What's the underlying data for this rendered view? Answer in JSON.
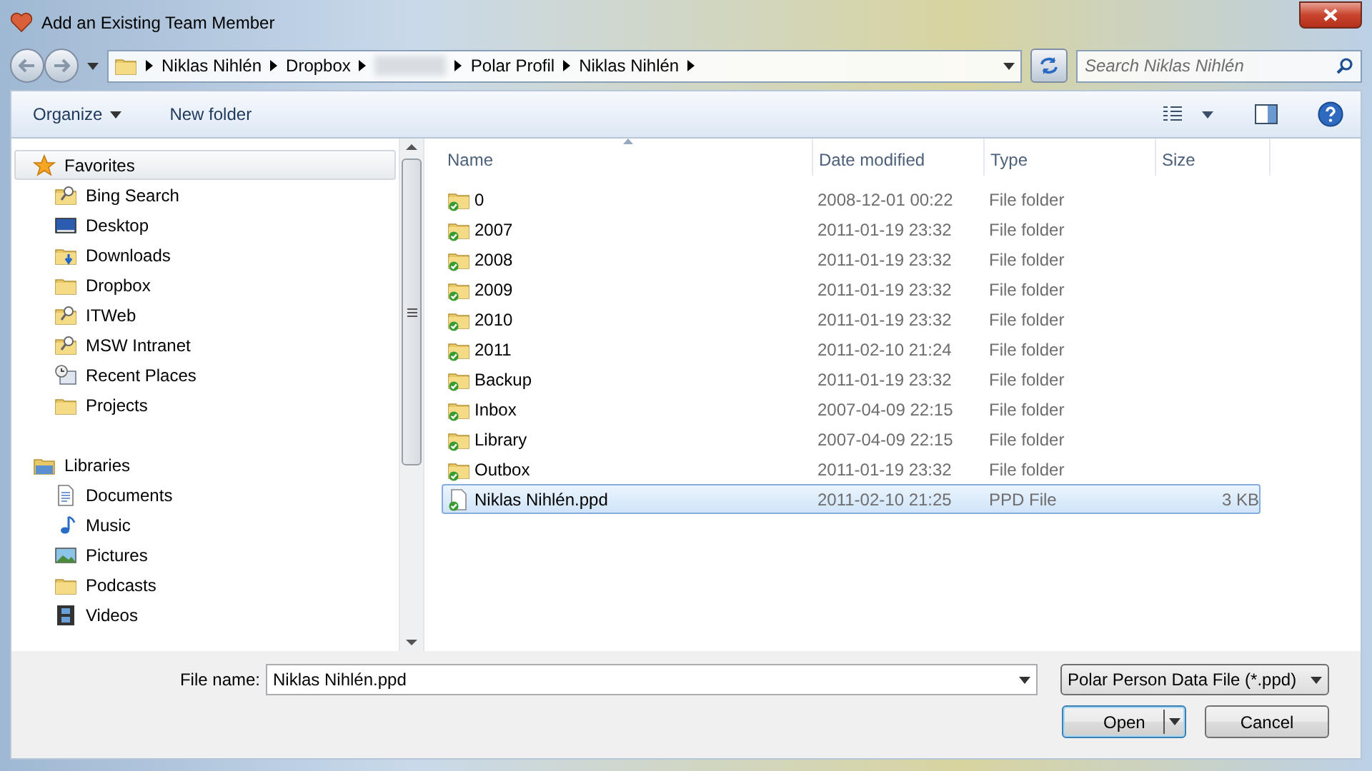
{
  "window": {
    "title": "Add an Existing Team Member"
  },
  "address": {
    "crumbs": [
      {
        "kind": "text",
        "label": "Niklas Nihlén"
      },
      {
        "kind": "text",
        "label": "Dropbox"
      },
      {
        "kind": "redacted"
      },
      {
        "kind": "text",
        "label": "Polar Profil"
      },
      {
        "kind": "text",
        "label": "Niklas Nihlén"
      }
    ],
    "search_placeholder": "Search Niklas Nihlén"
  },
  "toolbar": {
    "buttons": [
      {
        "label": "Organize",
        "dropdown": true
      },
      {
        "label": "New folder",
        "dropdown": false
      }
    ]
  },
  "nav": {
    "groups": [
      {
        "label": "Favorites",
        "kind": "star",
        "selected": true,
        "children": [
          {
            "label": "Bing Search",
            "kind": "search-folder"
          },
          {
            "label": "Desktop",
            "kind": "desktop"
          },
          {
            "label": "Downloads",
            "kind": "download-folder"
          },
          {
            "label": "Dropbox",
            "kind": "folder"
          },
          {
            "label": "ITWeb",
            "kind": "search-folder"
          },
          {
            "label": "MSW Intranet",
            "kind": "search-folder"
          },
          {
            "label": "Recent Places",
            "kind": "recent"
          },
          {
            "label": "Projects",
            "kind": "folder"
          }
        ]
      },
      {
        "label": "Libraries",
        "kind": "library",
        "selected": false,
        "children": [
          {
            "label": "Documents",
            "kind": "document"
          },
          {
            "label": "Music",
            "kind": "music"
          },
          {
            "label": "Pictures",
            "kind": "pictures"
          },
          {
            "label": "Podcasts",
            "kind": "folder"
          },
          {
            "label": "Videos",
            "kind": "video"
          }
        ]
      }
    ]
  },
  "file_list": {
    "columns": [
      {
        "label": "Name",
        "sorted": true
      },
      {
        "label": "Date modified",
        "sorted": false
      },
      {
        "label": "Type",
        "sorted": false
      },
      {
        "label": "Size",
        "sorted": false
      }
    ],
    "rows": [
      {
        "kind": "synced-folder",
        "name": "0",
        "date": "2008-12-01 00:22",
        "type": "File folder",
        "selected": false
      },
      {
        "kind": "synced-folder",
        "name": "2007",
        "date": "2011-01-19 23:32",
        "type": "File folder",
        "selected": false
      },
      {
        "kind": "synced-folder",
        "name": "2008",
        "date": "2011-01-19 23:32",
        "type": "File folder",
        "selected": false
      },
      {
        "kind": "synced-folder",
        "name": "2009",
        "date": "2011-01-19 23:32",
        "type": "File folder",
        "selected": false
      },
      {
        "kind": "synced-folder",
        "name": "2010",
        "date": "2011-01-19 23:32",
        "type": "File folder",
        "selected": false
      },
      {
        "kind": "synced-folder",
        "name": "2011",
        "date": "2011-02-10 21:24",
        "type": "File folder",
        "selected": false
      },
      {
        "kind": "synced-folder",
        "name": "Backup",
        "date": "2011-01-19 23:32",
        "type": "File folder",
        "selected": false
      },
      {
        "kind": "synced-folder",
        "name": "Inbox",
        "date": "2007-04-09 22:15",
        "type": "File folder",
        "selected": false
      },
      {
        "kind": "synced-folder",
        "name": "Library",
        "date": "2007-04-09 22:15",
        "type": "File folder",
        "selected": false
      },
      {
        "kind": "synced-folder",
        "name": "Outbox",
        "date": "2011-01-19 23:32",
        "type": "File folder",
        "selected": false
      },
      {
        "kind": "synced-file",
        "name": "Niklas Nihlén.ppd",
        "date": "2011-02-10 21:25",
        "type": "PPD File",
        "size": "3 KB",
        "selected": true
      }
    ]
  },
  "footer": {
    "file_name_label": "File name:",
    "file_name": "Niklas Nihlén.ppd",
    "file_type": "Polar Person Data File (*.ppd)",
    "open_label": "Open",
    "cancel_label": "Cancel"
  }
}
